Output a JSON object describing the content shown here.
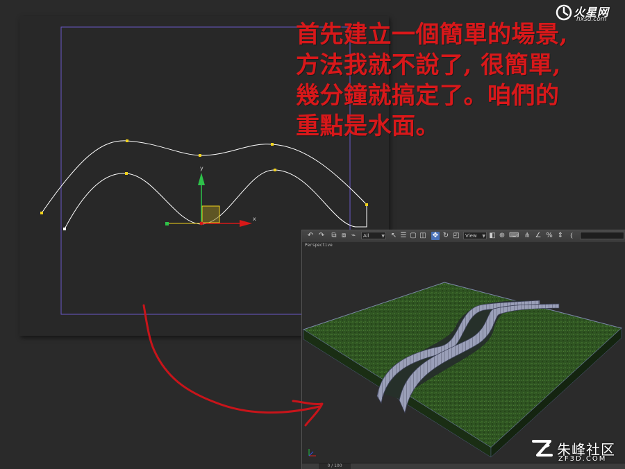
{
  "watermark_top": {
    "title": "火星网",
    "subtitle": "hxsd.com"
  },
  "caption_lines": [
    "首先建立一個簡單的場景,",
    "方法我就不說了, 很簡單,",
    "幾分鐘就搞定了。咱們的",
    "重點是水面。"
  ],
  "top_viewport": {
    "axis_x": "x",
    "axis_y": "y",
    "colors": {
      "bg": "#282828",
      "spline": "#ffffff",
      "vertex": "#f2d21a",
      "gizmo_y": "#2ec24a",
      "gizmo_x": "#d81818",
      "frame": "#6a58c8"
    }
  },
  "max_window": {
    "toolbar": {
      "selection_filter": "All",
      "view_dropdown": "View",
      "icons": [
        "undo-icon",
        "redo-icon",
        "link-icon",
        "unlink-icon",
        "bind-space-warp-icon",
        "select-object-icon",
        "select-by-name-icon",
        "rectangle-selection-icon",
        "window-crossing-icon",
        "move-icon",
        "rotate-icon",
        "scale-icon",
        "pivot-icon",
        "select-manipulate-icon",
        "keyboard-shortcut-icon",
        "snap-icon",
        "angle-snap-icon",
        "percent-snap-icon",
        "spinner-snap-icon",
        "named-selection-icon",
        "mirror-icon",
        "align-icon"
      ]
    },
    "viewport_label": "Perspective",
    "frame_counter": "0 / 100"
  },
  "watermark_bottom": {
    "name": "朱峰社区",
    "domain": "ZF3D.COM"
  }
}
